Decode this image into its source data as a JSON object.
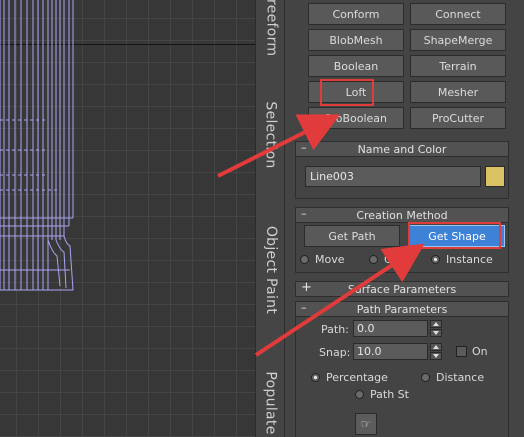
{
  "tabs": {
    "freeform": "Freeform",
    "selection": "Selection",
    "object_paint": "Object Paint",
    "populate": "Populate"
  },
  "object_types": [
    "Conform",
    "Connect",
    "BlobMesh",
    "ShapeMerge",
    "Boolean",
    "Terrain",
    "Loft",
    "Mesher",
    "ProBoolean",
    "ProCutter"
  ],
  "name_and_color": {
    "header": "Name and Color",
    "collapse": "–",
    "name": "Line003",
    "color": "#d9c365"
  },
  "creation_method": {
    "header": "Creation Method",
    "collapse": "–",
    "get_path": "Get Path",
    "get_shape": "Get Shape",
    "move": "Move",
    "copy": "Copy",
    "instance": "Instance",
    "selected": "instance"
  },
  "surface_parameters": {
    "header": "Surface Parameters",
    "expand": "+"
  },
  "path_parameters": {
    "header": "Path Parameters",
    "collapse": "–",
    "path_label": "Path:",
    "path_value": "0.0",
    "snap_label": "Snap:",
    "snap_value": "10.0",
    "on_label": "On",
    "percentage": "Percentage",
    "distance": "Distance",
    "path_steps": "Path St",
    "selected": "percentage"
  },
  "highlight_color": "#e23b3b"
}
